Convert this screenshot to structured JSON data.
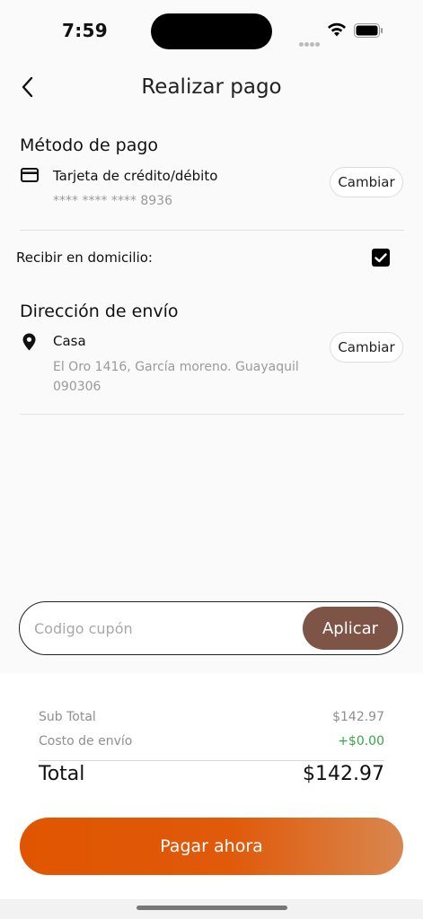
{
  "status_bar": {
    "time": "7:59"
  },
  "header": {
    "title": "Realizar pago"
  },
  "payment_method": {
    "section_title": "Método de pago",
    "card_label": "Tarjeta de crédito/débito",
    "card_number": "**** **** **** 8936",
    "change_label": "Cambiar"
  },
  "home_delivery": {
    "label": "Recibir en domicilio:",
    "checked": true
  },
  "shipping": {
    "section_title": "Dirección de envío",
    "address_name": "Casa",
    "address_line1": "El Oro 1416, García moreno. Guayaquil",
    "address_line2": "090306",
    "change_label": "Cambiar"
  },
  "coupon": {
    "placeholder": "Codigo cupón",
    "value": "",
    "apply_label": "Aplicar"
  },
  "summary": {
    "subtotal_label": "Sub Total",
    "subtotal_value": "$142.97",
    "shipping_label": "Costo de envío",
    "shipping_value": "+$0.00",
    "total_label": "Total",
    "total_value": "$142.97"
  },
  "actions": {
    "pay_label": "Pagar ahora"
  },
  "colors": {
    "accent": "#e05500",
    "apply_button": "#7d5445",
    "positive": "#3aa546"
  }
}
